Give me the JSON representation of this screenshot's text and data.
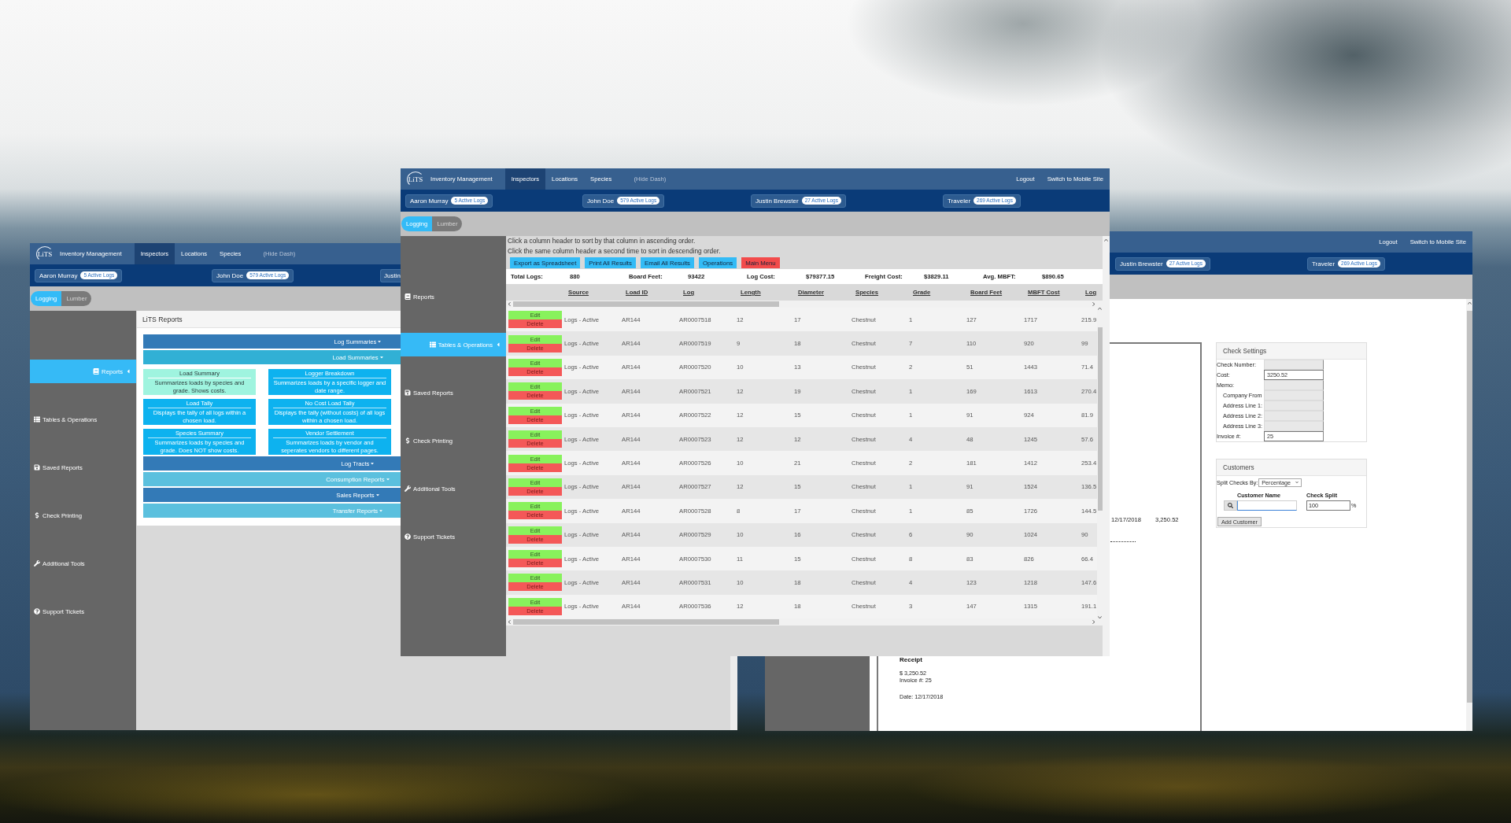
{
  "logs_window": {
    "nav": {
      "logo": "LiTS",
      "brand": "Inventory Management",
      "tabs": [
        {
          "label": "Inspectors",
          "selected": true
        },
        {
          "label": "Locations",
          "selected": false
        },
        {
          "label": "Species",
          "selected": false
        }
      ],
      "hide_dash": "(Hide Dash)",
      "links": [
        "Logout",
        "Switch to Mobile Site"
      ]
    },
    "inspectors": [
      {
        "name": "Aaron Murray",
        "badge": "5 Active Logs"
      },
      {
        "name": "John Doe",
        "badge": "579 Active Logs"
      },
      {
        "name": "Justin Brewster",
        "badge": "27 Active Logs"
      },
      {
        "name": "Traveler",
        "badge": "269 Active Logs"
      }
    ],
    "modes": [
      {
        "label": "Logging",
        "selected": true
      },
      {
        "label": "Lumber",
        "selected": false
      }
    ],
    "sidebar": [
      {
        "label": "Reports",
        "selected": false
      },
      {
        "label": "Tables & Operations",
        "selected": true
      },
      {
        "label": "Saved Reports",
        "selected": false
      },
      {
        "label": "Check Printing",
        "selected": false
      },
      {
        "label": "Additional Tools",
        "selected": false
      },
      {
        "label": "Support Tickets",
        "selected": false
      }
    ],
    "instructions": [
      "Click a column header to sort by that column in ascending order.",
      "Click the same column header a second time to sort in descending order."
    ],
    "actions": [
      {
        "label": "Export as Spreadsheet",
        "kind": "info"
      },
      {
        "label": "Print All Results",
        "kind": "info"
      },
      {
        "label": "Email All Results",
        "kind": "info"
      },
      {
        "label": "Operations",
        "kind": "info"
      },
      {
        "label": "Main Menu",
        "kind": "danger"
      }
    ],
    "totals": [
      {
        "label": "Total Logs:",
        "value": "880"
      },
      {
        "label": "Board Feet:",
        "value": "93422"
      },
      {
        "label": "Log Cost:",
        "value": "$79377.15"
      },
      {
        "label": "Freight Cost:",
        "value": "$3829.11"
      },
      {
        "label": "Avg. MBFT:",
        "value": "$890.65"
      }
    ],
    "table": {
      "columns": [
        "Source",
        "Load ID",
        "Log",
        "Length",
        "Diameter",
        "Species",
        "Grade",
        "Board Feet",
        "MBFT Cost",
        "Log"
      ],
      "rows": [
        {
          "edit": "Edit",
          "delete": "Delete",
          "cells": [
            "Logs - Active",
            "AR144",
            "AR0007518",
            "12",
            "17",
            "Chestnut",
            "1",
            "127",
            "1717",
            "215.9"
          ]
        },
        {
          "edit": "Edit",
          "delete": "Delete",
          "cells": [
            "Logs - Active",
            "AR144",
            "AR0007519",
            "9",
            "18",
            "Chestnut",
            "7",
            "110",
            "920",
            "99"
          ]
        },
        {
          "edit": "Edit",
          "delete": "Delete",
          "cells": [
            "Logs - Active",
            "AR144",
            "AR0007520",
            "10",
            "13",
            "Chestnut",
            "2",
            "51",
            "1443",
            "71.4"
          ]
        },
        {
          "edit": "Edit",
          "delete": "Delete",
          "cells": [
            "Logs - Active",
            "AR144",
            "AR0007521",
            "12",
            "19",
            "Chestnut",
            "1",
            "169",
            "1613",
            "270.4"
          ]
        },
        {
          "edit": "Edit",
          "delete": "Delete",
          "cells": [
            "Logs - Active",
            "AR144",
            "AR0007522",
            "12",
            "15",
            "Chestnut",
            "1",
            "91",
            "924",
            "81.9"
          ]
        },
        {
          "edit": "Edit",
          "delete": "Delete",
          "cells": [
            "Logs - Active",
            "AR144",
            "AR0007523",
            "12",
            "12",
            "Chestnut",
            "4",
            "48",
            "1245",
            "57.6"
          ]
        },
        {
          "edit": "Edit",
          "delete": "Delete",
          "cells": [
            "Logs - Active",
            "AR144",
            "AR0007526",
            "10",
            "21",
            "Chestnut",
            "2",
            "181",
            "1412",
            "253.4"
          ]
        },
        {
          "edit": "Edit",
          "delete": "Delete",
          "cells": [
            "Logs - Active",
            "AR144",
            "AR0007527",
            "12",
            "15",
            "Chestnut",
            "1",
            "91",
            "1524",
            "136.5"
          ]
        },
        {
          "edit": "Edit",
          "delete": "Delete",
          "cells": [
            "Logs - Active",
            "AR144",
            "AR0007528",
            "8",
            "17",
            "Chestnut",
            "1",
            "85",
            "1726",
            "144.5"
          ]
        },
        {
          "edit": "Edit",
          "delete": "Delete",
          "cells": [
            "Logs - Active",
            "AR144",
            "AR0007529",
            "10",
            "16",
            "Chestnut",
            "6",
            "90",
            "1024",
            "90"
          ]
        },
        {
          "edit": "Edit",
          "delete": "Delete",
          "cells": [
            "Logs - Active",
            "AR144",
            "AR0007530",
            "11",
            "15",
            "Chestnut",
            "8",
            "83",
            "826",
            "66.4"
          ]
        },
        {
          "edit": "Edit",
          "delete": "Delete",
          "cells": [
            "Logs - Active",
            "AR144",
            "AR0007531",
            "10",
            "18",
            "Chestnut",
            "4",
            "123",
            "1218",
            "147.6"
          ]
        },
        {
          "edit": "Edit",
          "delete": "Delete",
          "cells": [
            "Logs - Active",
            "AR144",
            "AR0007536",
            "12",
            "18",
            "Chestnut",
            "3",
            "147",
            "1315",
            "191.1"
          ]
        }
      ]
    }
  },
  "reports_window": {
    "nav": {
      "logo": "LiTS",
      "brand": "Inventory Management",
      "tabs": [
        {
          "label": "Inspectors",
          "selected": true
        },
        {
          "label": "Locations",
          "selected": false
        },
        {
          "label": "Species",
          "selected": false
        }
      ],
      "hide_dash": "(Hide Dash)"
    },
    "inspectors": [
      {
        "name": "Aaron Murray",
        "badge": "5 Active Logs"
      },
      {
        "name": "John Doe",
        "badge": "579 Active Logs"
      },
      {
        "name": "Justin"
      }
    ],
    "modes": [
      {
        "label": "Logging",
        "selected": true
      },
      {
        "label": "Lumber",
        "selected": false
      }
    ],
    "sidebar": [
      {
        "label": "Reports",
        "selected": true
      },
      {
        "label": "Tables & Operations",
        "selected": false
      },
      {
        "label": "Saved Reports",
        "selected": false
      },
      {
        "label": "Check Printing",
        "selected": false
      },
      {
        "label": "Additional Tools",
        "selected": false
      },
      {
        "label": "Support Tickets",
        "selected": false
      }
    ],
    "panel": {
      "title": "LiTS Reports",
      "sections": [
        {
          "label": "Log Summaries",
          "kind": "primary",
          "expanded": false
        },
        {
          "label": "Load Summaries",
          "kind": "info",
          "expanded": true,
          "reports": [
            {
              "title": "Load Summary",
              "description": "Summarizes loads by species and grade. Shows costs.",
              "highlighted": true
            },
            {
              "title": "Logger Breakdown",
              "description": "Summarizes loads by a specific logger and date range.",
              "highlighted": false
            },
            {
              "title": "Load Tally",
              "description": "Displays the tally of all logs within a chosen load.",
              "highlighted": false
            },
            {
              "title": "No Cost Load Tally",
              "description": "Displays the tally (without costs) of all logs within a chosen load.",
              "highlighted": false
            },
            {
              "title": "Species Summary",
              "description": "Summarizes loads by species and grade. Does NOT show costs.",
              "highlighted": false
            },
            {
              "title": "Vendor Settlement",
              "description": "Summarizes loads by vendor and seperates vendors to different pages.",
              "highlighted": false
            }
          ]
        },
        {
          "label": "Log Tracts",
          "kind": "primary",
          "expanded": false
        },
        {
          "label": "Consumption Reports",
          "kind": "info",
          "expanded": false
        },
        {
          "label": "Sales Reports",
          "kind": "primary",
          "expanded": false
        },
        {
          "label": "Transfer Reports",
          "kind": "info",
          "expanded": false
        }
      ]
    }
  },
  "check_window": {
    "nav": {
      "links": [
        "Logout",
        "Switch to Mobile Site"
      ]
    },
    "inspectors": [
      {
        "name": "Justin Brewster",
        "badge": "27 Active Logs"
      },
      {
        "name": "Traveler",
        "badge": "269 Active Logs"
      }
    ],
    "check_preview": {
      "date": "12/17/2018",
      "amount": "3,250.52"
    },
    "receipt": {
      "title": "Receipt",
      "amount": "$ 3,250.52",
      "invoice": "Invoice #: 25",
      "date": "Date: 12/17/2018"
    },
    "check_settings": {
      "title": "Check Settings",
      "fields": [
        {
          "label": "Check Number:",
          "disabled": true
        },
        {
          "label": "Cost:",
          "value": "3250.52",
          "disabled": false
        },
        {
          "label": "Memo:",
          "disabled": true,
          "children": [
            {
              "label": "Company From",
              "disabled": true
            },
            {
              "label": "Address Line 1:",
              "disabled": true
            },
            {
              "label": "Address Line 2:",
              "disabled": true
            },
            {
              "label": "Address Line 3:",
              "disabled": true
            }
          ]
        },
        {
          "label": "Invoice #:",
          "value": "25",
          "disabled": false
        }
      ]
    },
    "customers": {
      "title": "Customers",
      "split_label": "Split Checks By:",
      "split_value": "Percentage",
      "name_heading": "Customer Name",
      "split_heading": "Check Split",
      "name_focused": true,
      "split_amount": "100",
      "percent": "%",
      "add_button": "Add Customer"
    }
  }
}
